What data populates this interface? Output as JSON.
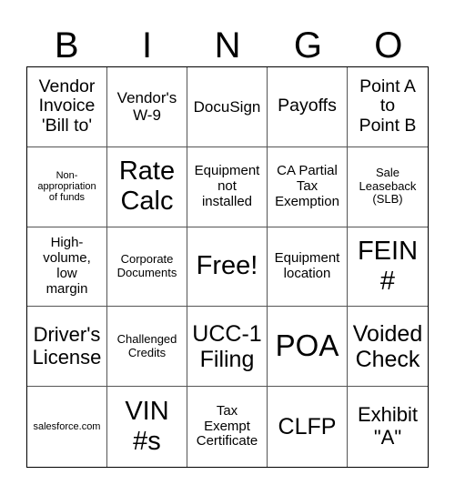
{
  "header": {
    "letters": [
      "B",
      "I",
      "N",
      "G",
      "O"
    ]
  },
  "cells": [
    "Vendor\nInvoice\n'Bill to'",
    "Vendor's\nW-9",
    "DocuSign",
    "Payoffs",
    "Point A\nto\nPoint B",
    "Non-\nappropriation\nof funds",
    "Rate\nCalc",
    "Equipment\nnot\ninstalled",
    "CA Partial\nTax\nExemption",
    "Sale\nLeaseback\n(SLB)",
    "High-\nvolume,\nlow\nmargin",
    "Corporate\nDocuments",
    "Free!",
    "Equipment\nlocation",
    "FEIN\n#",
    "Driver's\nLicense",
    "Challenged\nCredits",
    "UCC-1\nFiling",
    "POA",
    "Voided\nCheck",
    "salesforce.com",
    "VIN\n#s",
    "Tax\nExempt\nCertificate",
    "CLFP",
    "Exhibit\n\"A\""
  ]
}
